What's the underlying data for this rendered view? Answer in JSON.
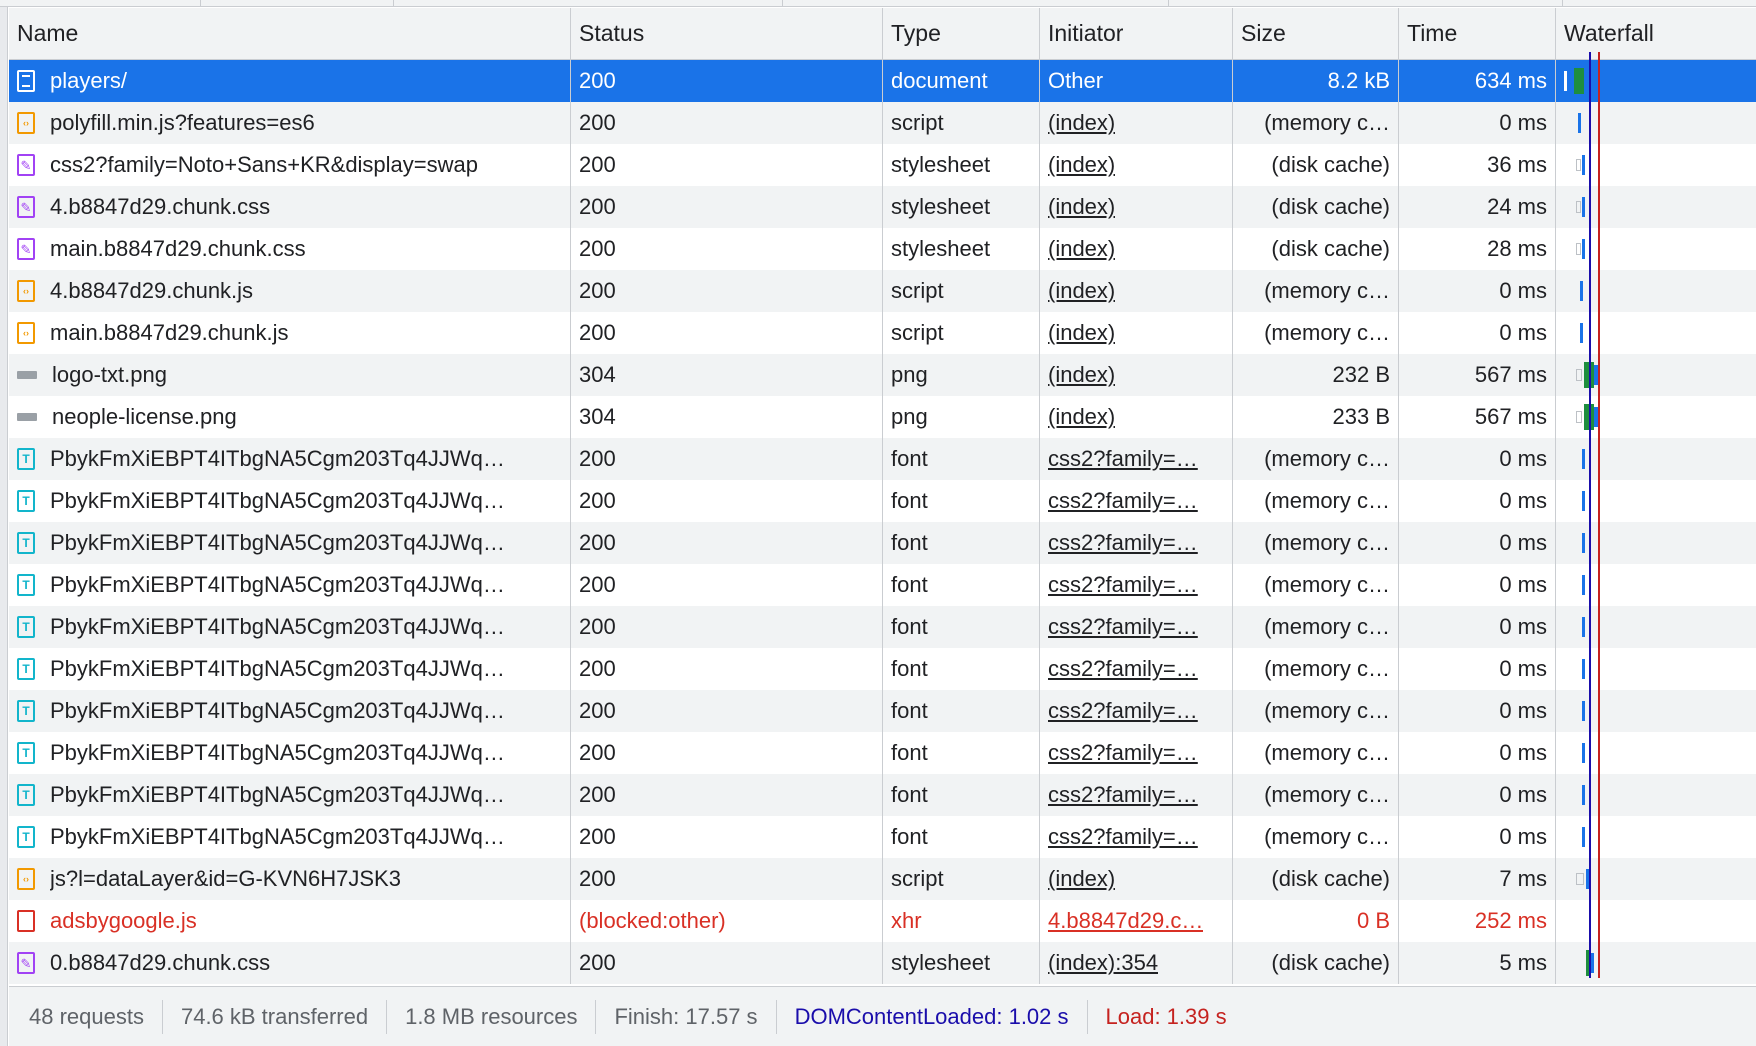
{
  "columns": {
    "name": "Name",
    "status": "Status",
    "type": "Type",
    "initiator": "Initiator",
    "size": "Size",
    "time": "Time",
    "waterfall": "Waterfall"
  },
  "requests": [
    {
      "name": "players/",
      "icon": "document-icon",
      "status": "200",
      "type": "document",
      "initiator": "Other",
      "size": "8.2 kB",
      "time": "634 ms"
    },
    {
      "name": "polyfill.min.js?features=es6",
      "icon": "script-icon",
      "status": "200",
      "type": "script",
      "initiator": "(index)",
      "size": "(memory c…",
      "time": "0 ms"
    },
    {
      "name": "css2?family=Noto+Sans+KR&display=swap",
      "icon": "stylesheet-icon",
      "status": "200",
      "type": "stylesheet",
      "initiator": "(index)",
      "size": "(disk cache)",
      "time": "36 ms"
    },
    {
      "name": "4.b8847d29.chunk.css",
      "icon": "stylesheet-icon",
      "status": "200",
      "type": "stylesheet",
      "initiator": "(index)",
      "size": "(disk cache)",
      "time": "24 ms"
    },
    {
      "name": "main.b8847d29.chunk.css",
      "icon": "stylesheet-icon",
      "status": "200",
      "type": "stylesheet",
      "initiator": "(index)",
      "size": "(disk cache)",
      "time": "28 ms"
    },
    {
      "name": "4.b8847d29.chunk.js",
      "icon": "script-icon",
      "status": "200",
      "type": "script",
      "initiator": "(index)",
      "size": "(memory c…",
      "time": "0 ms"
    },
    {
      "name": "main.b8847d29.chunk.js",
      "icon": "script-icon",
      "status": "200",
      "type": "script",
      "initiator": "(index)",
      "size": "(memory c…",
      "time": "0 ms"
    },
    {
      "name": "logo-txt.png",
      "icon": "image-icon",
      "status": "304",
      "type": "png",
      "initiator": "(index)",
      "size": "232 B",
      "time": "567 ms"
    },
    {
      "name": "neople-license.png",
      "icon": "image-icon",
      "status": "304",
      "type": "png",
      "initiator": "(index)",
      "size": "233 B",
      "time": "567 ms"
    },
    {
      "name": "PbykFmXiEBPT4ITbgNA5Cgm203Tq4JJWq…",
      "icon": "font-icon",
      "status": "200",
      "type": "font",
      "initiator": "css2?family=…",
      "size": "(memory c…",
      "time": "0 ms"
    },
    {
      "name": "PbykFmXiEBPT4ITbgNA5Cgm203Tq4JJWq…",
      "icon": "font-icon",
      "status": "200",
      "type": "font",
      "initiator": "css2?family=…",
      "size": "(memory c…",
      "time": "0 ms"
    },
    {
      "name": "PbykFmXiEBPT4ITbgNA5Cgm203Tq4JJWq…",
      "icon": "font-icon",
      "status": "200",
      "type": "font",
      "initiator": "css2?family=…",
      "size": "(memory c…",
      "time": "0 ms"
    },
    {
      "name": "PbykFmXiEBPT4ITbgNA5Cgm203Tq4JJWq…",
      "icon": "font-icon",
      "status": "200",
      "type": "font",
      "initiator": "css2?family=…",
      "size": "(memory c…",
      "time": "0 ms"
    },
    {
      "name": "PbykFmXiEBPT4ITbgNA5Cgm203Tq4JJWq…",
      "icon": "font-icon",
      "status": "200",
      "type": "font",
      "initiator": "css2?family=…",
      "size": "(memory c…",
      "time": "0 ms"
    },
    {
      "name": "PbykFmXiEBPT4ITbgNA5Cgm203Tq4JJWq…",
      "icon": "font-icon",
      "status": "200",
      "type": "font",
      "initiator": "css2?family=…",
      "size": "(memory c…",
      "time": "0 ms"
    },
    {
      "name": "PbykFmXiEBPT4ITbgNA5Cgm203Tq4JJWq…",
      "icon": "font-icon",
      "status": "200",
      "type": "font",
      "initiator": "css2?family=…",
      "size": "(memory c…",
      "time": "0 ms"
    },
    {
      "name": "PbykFmXiEBPT4ITbgNA5Cgm203Tq4JJWq…",
      "icon": "font-icon",
      "status": "200",
      "type": "font",
      "initiator": "css2?family=…",
      "size": "(memory c…",
      "time": "0 ms"
    },
    {
      "name": "PbykFmXiEBPT4ITbgNA5Cgm203Tq4JJWq…",
      "icon": "font-icon",
      "status": "200",
      "type": "font",
      "initiator": "css2?family=…",
      "size": "(memory c…",
      "time": "0 ms"
    },
    {
      "name": "PbykFmXiEBPT4ITbgNA5Cgm203Tq4JJWq…",
      "icon": "font-icon",
      "status": "200",
      "type": "font",
      "initiator": "css2?family=…",
      "size": "(memory c…",
      "time": "0 ms"
    },
    {
      "name": "js?l=dataLayer&id=G-KVN6H7JSK3",
      "icon": "script-icon",
      "status": "200",
      "type": "script",
      "initiator": "(index)",
      "size": "(disk cache)",
      "time": "7 ms"
    },
    {
      "name": "adsbygoogle.js",
      "icon": "error-icon",
      "status": "(blocked:other)",
      "type": "xhr",
      "initiator": "4.b8847d29.c…",
      "size": "0 B",
      "time": "252 ms"
    },
    {
      "name": "0.b8847d29.chunk.css",
      "icon": "stylesheet-icon",
      "status": "200",
      "type": "stylesheet",
      "initiator": "(index):354",
      "size": "(disk cache)",
      "time": "5 ms"
    }
  ],
  "footer": {
    "requests": "48 requests",
    "transferred": "74.6 kB transferred",
    "resources": "1.8 MB resources",
    "finish": "Finish: 17.57 s",
    "dcl": "DOMContentLoaded: 1.02 s",
    "load": "Load: 1.39 s"
  },
  "colors": {
    "selected": "#1a73e8",
    "error": "#d93025",
    "dcl_line": "#1a0dab",
    "load_line": "#c5221f",
    "waterfall_green": "#1e8e3e",
    "waterfall_blue": "#1a73e8"
  }
}
